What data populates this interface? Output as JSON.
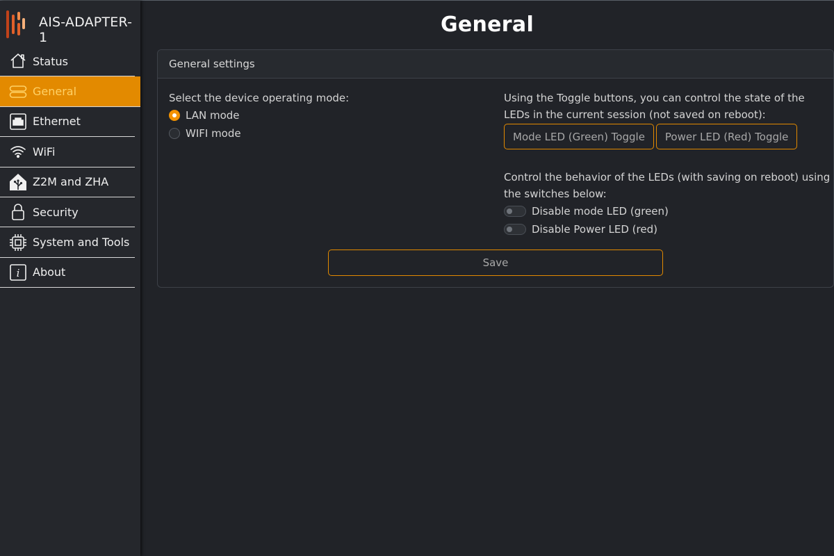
{
  "app": {
    "title": "AIS-ADAPTER-1"
  },
  "sidebar": {
    "items": [
      {
        "label": "Status",
        "icon": "home-icon",
        "active": false
      },
      {
        "label": "General",
        "icon": "settings-list-icon",
        "active": true
      },
      {
        "label": "Ethernet",
        "icon": "ethernet-port-icon",
        "active": false
      },
      {
        "label": "WiFi",
        "icon": "wifi-icon",
        "active": false
      },
      {
        "label": "Z2M and ZHA",
        "icon": "home-assistant-icon",
        "active": false
      },
      {
        "label": "Security",
        "icon": "lock-icon",
        "active": false
      },
      {
        "label": "System and Tools",
        "icon": "chip-icon",
        "active": false
      },
      {
        "label": "About",
        "icon": "info-icon",
        "active": false
      }
    ]
  },
  "page": {
    "title": "General"
  },
  "card": {
    "header": "General settings",
    "mode": {
      "prompt": "Select the device operating mode:",
      "options": [
        {
          "label": "LAN mode",
          "checked": true
        },
        {
          "label": "WIFI mode",
          "checked": false
        }
      ]
    },
    "leds": {
      "toggle_text": "Using the Toggle buttons, you can control the state of the LEDs in the current session (not saved on reboot):",
      "toggle_buttons": [
        "Mode LED (Green) Toggle",
        "Power LED (Red) Toggle"
      ],
      "switch_text": "Control the behavior of the LEDs (with saving on reboot) using the switches below:",
      "switches": [
        {
          "label": "Disable mode LED (green)",
          "on": false
        },
        {
          "label": "Disable Power LED (red)",
          "on": false
        }
      ]
    },
    "save_label": "Save"
  },
  "colors": {
    "accent": "#e38a00",
    "background": "#212328",
    "sidebar": "#25272c",
    "active_text": "#ffd166"
  }
}
